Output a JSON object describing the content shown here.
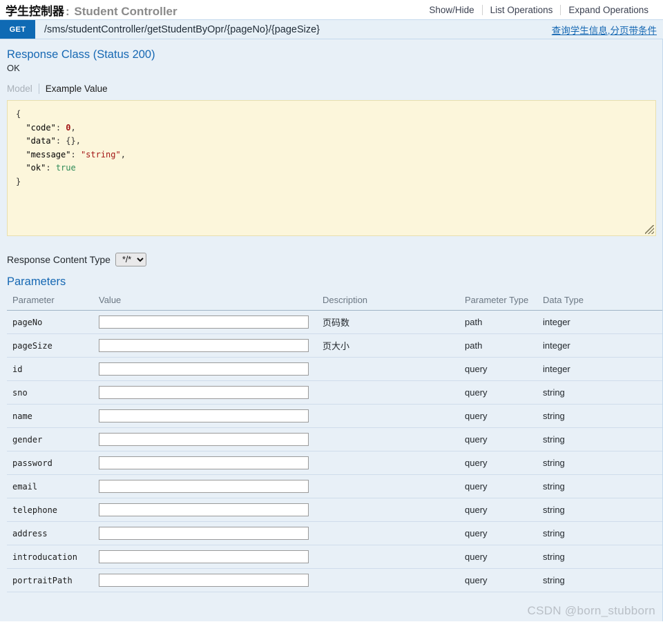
{
  "resource": {
    "title_cn": "学生控制器",
    "title_sep": ":",
    "title_en": "Student Controller",
    "options": [
      {
        "label": "Show/Hide"
      },
      {
        "label": "List Operations"
      },
      {
        "label": "Expand Operations"
      }
    ]
  },
  "operation": {
    "method": "GET",
    "path": "/sms/studentController/getStudentByOpr/{pageNo}/{pageSize}",
    "summary": "查询学生信息,分页带条件"
  },
  "response_class": {
    "heading": "Response Class (Status 200)",
    "status_text": "OK",
    "tabs": [
      {
        "label": "Model",
        "active": false
      },
      {
        "label": "Example Value",
        "active": true
      }
    ],
    "example_value": {
      "code_key": "\"code\"",
      "code_value": "0",
      "data_key": "\"data\"",
      "data_value": "{}",
      "message_key": "\"message\"",
      "message_value": "\"string\"",
      "ok_key": "\"ok\"",
      "ok_value": "true",
      "open_brace": "{",
      "close_brace": "}",
      "colon": ": ",
      "comma": ","
    }
  },
  "content_type": {
    "label": "Response Content Type",
    "selected": "*/*",
    "options": [
      "*/*"
    ]
  },
  "parameters": {
    "heading": "Parameters",
    "columns": {
      "parameter": "Parameter",
      "value": "Value",
      "description": "Description",
      "parameter_type": "Parameter Type",
      "data_type": "Data Type"
    },
    "rows": [
      {
        "name": "pageNo",
        "value": "",
        "description": "页码数",
        "param_type": "path",
        "data_type": "integer"
      },
      {
        "name": "pageSize",
        "value": "",
        "description": "页大小",
        "param_type": "path",
        "data_type": "integer"
      },
      {
        "name": "id",
        "value": "",
        "description": "",
        "param_type": "query",
        "data_type": "integer"
      },
      {
        "name": "sno",
        "value": "",
        "description": "",
        "param_type": "query",
        "data_type": "string"
      },
      {
        "name": "name",
        "value": "",
        "description": "",
        "param_type": "query",
        "data_type": "string"
      },
      {
        "name": "gender",
        "value": "",
        "description": "",
        "param_type": "query",
        "data_type": "string"
      },
      {
        "name": "password",
        "value": "",
        "description": "",
        "param_type": "query",
        "data_type": "string"
      },
      {
        "name": "email",
        "value": "",
        "description": "",
        "param_type": "query",
        "data_type": "string"
      },
      {
        "name": "telephone",
        "value": "",
        "description": "",
        "param_type": "query",
        "data_type": "string"
      },
      {
        "name": "address",
        "value": "",
        "description": "",
        "param_type": "query",
        "data_type": "string"
      },
      {
        "name": "introducation",
        "value": "",
        "description": "",
        "param_type": "query",
        "data_type": "string"
      },
      {
        "name": "portraitPath",
        "value": "",
        "description": "",
        "param_type": "query",
        "data_type": "string"
      }
    ]
  },
  "watermark": "CSDN @born_stubborn",
  "colors": {
    "method_badge": "#0f6ab4",
    "link_blue": "#1668b3",
    "panel_bg": "#e8f0f7",
    "op_bar_bg": "#e7f0f7",
    "example_bg": "#fcf6db",
    "example_border": "#e8dfae"
  }
}
